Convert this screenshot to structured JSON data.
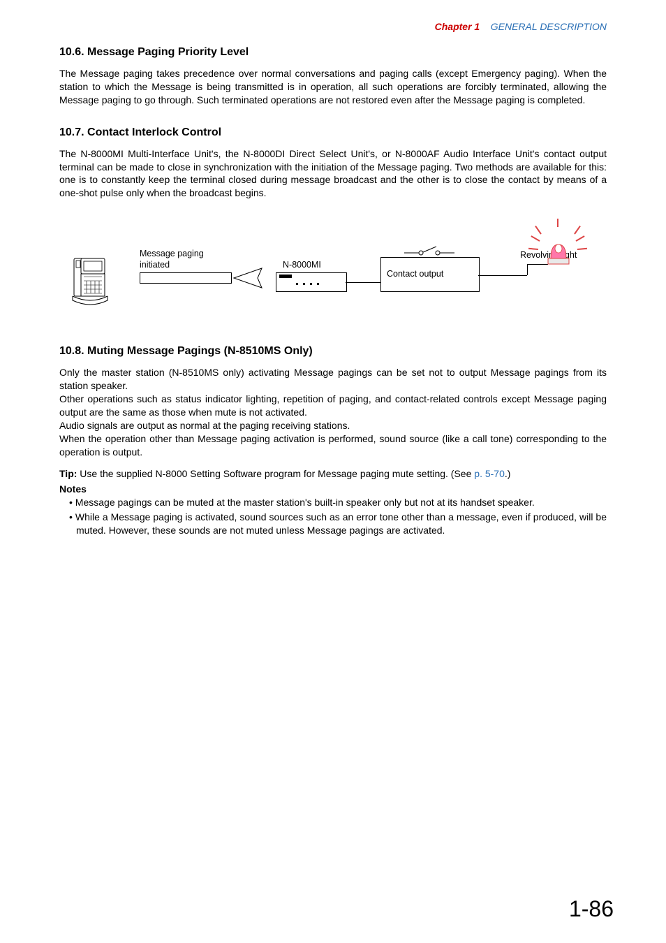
{
  "header": {
    "chapter": "Chapter 1",
    "title": "GENERAL DESCRIPTION"
  },
  "sec106": {
    "heading": "10.6. Message Paging Priority Level",
    "para1": "The Message paging takes precedence over normal conversations and paging calls (except Emergency paging). When the station to which the Message is being transmitted is in operation, all such operations are forcibly terminated, allowing the Message paging to go through. Such terminated operations are not restored even after the Message paging is completed."
  },
  "sec107": {
    "heading": "10.7. Contact Interlock Control",
    "para1": "The N-8000MI Multi-Interface Unit's, the N-8000DI Direct Select Unit's, or N-8000AF Audio Interface Unit's contact output terminal can be made to close in synchronization with the initiation of the Message paging. Two methods are available for this: one is to constantly keep the terminal closed during message broadcast and the other is to close the contact by means of a one-shot pulse only when the broadcast begins."
  },
  "diagram": {
    "msg_paging1": "Message paging",
    "msg_paging2": "initiated",
    "n8000mi": "N-8000MI",
    "contact_output": "Contact output",
    "revolving_light": "Revolving light"
  },
  "sec108": {
    "heading": "10.8. Muting Message Pagings (N-8510MS Only)",
    "para1": "Only the master station (N-8510MS only) activating Message pagings can be set not to output Message pagings from its station speaker.",
    "para2": "Other operations such as status indicator lighting, repetition of paging, and contact-related controls except Message paging output are the same as those when mute is not activated.",
    "para3": "Audio signals are output as normal at the paging receiving stations.",
    "para4": "When the operation other than Message paging activation is performed, sound source (like a call tone) corresponding to the operation is output.",
    "tip_label": "Tip:",
    "tip_text": " Use the supplied N-8000 Setting Software program for Message paging mute setting. (See ",
    "tip_link": "p. 5-70",
    "tip_after": ".)",
    "notes_label": "Notes",
    "note1": "Message pagings can be muted at the master station's built-in speaker only but not at its handset speaker.",
    "note2": "While a Message paging is activated, sound sources such as an error tone other than a message, even if produced, will be muted. However, these sounds are not muted unless Message pagings are activated."
  },
  "page_number": "1-86"
}
